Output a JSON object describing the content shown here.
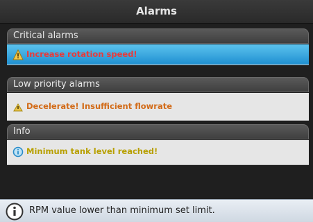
{
  "window": {
    "title": "Alarms"
  },
  "sections": {
    "critical": {
      "header": "Critical alarms",
      "alarms": [
        {
          "text": "Increase rotation speed!",
          "icon": "warning-triangle-icon",
          "color": "#e83a3a",
          "selected": true
        }
      ]
    },
    "low_priority": {
      "header": "Low priority alarms",
      "alarms": [
        {
          "text": "Decelerate! Insufficient flowrate",
          "icon": "warning-small-icon",
          "color": "#d26b18",
          "selected": false
        }
      ]
    },
    "info": {
      "header": "Info",
      "alarms": [
        {
          "text": "Minimum tank level reached!",
          "icon": "info-circle-icon",
          "color": "#b8a000",
          "selected": false
        }
      ]
    }
  },
  "status_bar": {
    "icon": "info-icon",
    "message": "RPM value lower than minimum set limit."
  },
  "colors": {
    "selected_row": "#1f8fd0",
    "critical_text": "#e83a3a",
    "low_priority_text": "#d26b18",
    "info_text": "#b8a000"
  }
}
